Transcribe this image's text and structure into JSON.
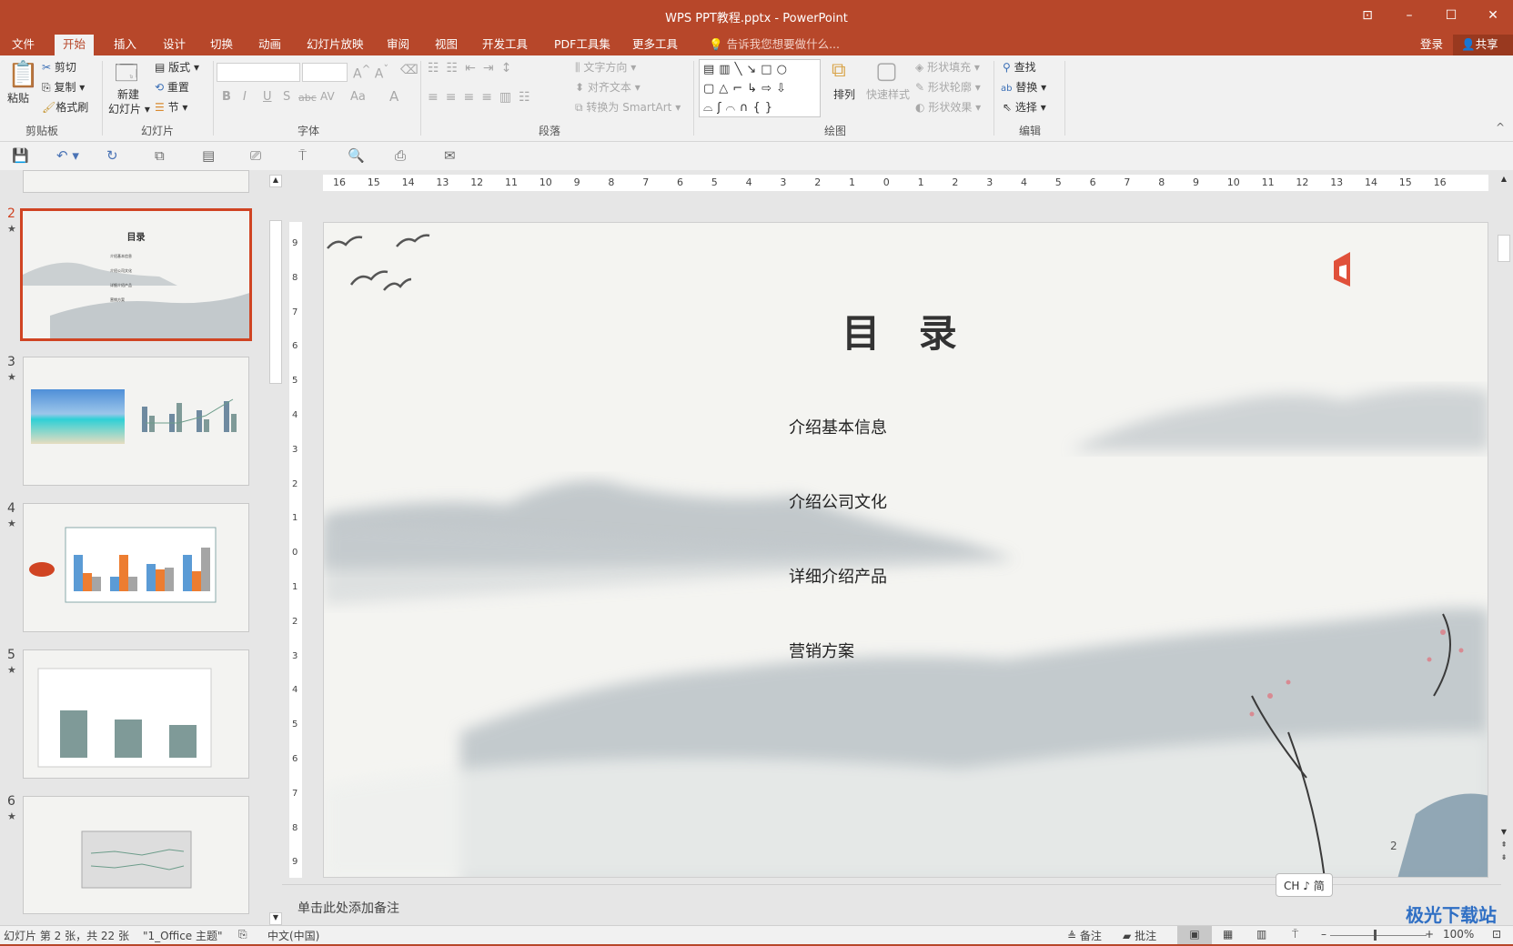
{
  "window": {
    "title": "WPS PPT教程.pptx - PowerPoint"
  },
  "tabs": [
    "文件",
    "开始",
    "插入",
    "设计",
    "切换",
    "动画",
    "幻灯片放映",
    "审阅",
    "视图",
    "开发工具",
    "PDF工具集",
    "更多工具"
  ],
  "tell_me": "告诉我您想要做什么...",
  "signin": "登录",
  "share": "共享",
  "ribbon": {
    "clipboard": {
      "paste": "粘贴",
      "cut": "剪切",
      "copy": "复制",
      "format_painter": "格式刷",
      "label": "剪贴板"
    },
    "slides": {
      "new_slide_1": "新建",
      "new_slide_2": "幻灯片",
      "layout": "版式",
      "reset": "重置",
      "section": "节",
      "label": "幻灯片"
    },
    "font": {
      "label": "字体",
      "bold": "B",
      "italic": "I",
      "underline": "U",
      "shadow": "S",
      "strike": "abc",
      "spacing": "AV",
      "case": "Aa",
      "color": "A"
    },
    "paragraph": {
      "text_direction": "文字方向",
      "align_text": "对齐文本",
      "smartart": "转换为 SmartArt",
      "label": "段落"
    },
    "drawing": {
      "arrange": "排列",
      "quick_styles": "快速样式",
      "shape_fill": "形状填充",
      "shape_outline": "形状轮廓",
      "shape_effects": "形状效果",
      "label": "绘图"
    },
    "editing": {
      "find": "查找",
      "replace": "替换",
      "select": "选择",
      "label": "编辑"
    }
  },
  "thumbnails": [
    {
      "num": "2",
      "star": "★",
      "title": "目录",
      "items": [
        "介绍基本信息",
        "介绍公司文化",
        "详细介绍产品",
        "营销方案"
      ]
    },
    {
      "num": "3",
      "star": "★"
    },
    {
      "num": "4",
      "star": "★"
    },
    {
      "num": "5",
      "star": "★"
    },
    {
      "num": "6",
      "star": "★"
    }
  ],
  "ruler_h": [
    "16",
    "15",
    "14",
    "13",
    "12",
    "11",
    "10",
    "9",
    "8",
    "7",
    "6",
    "5",
    "4",
    "3",
    "2",
    "1",
    "0",
    "1",
    "2",
    "3",
    "4",
    "5",
    "6",
    "7",
    "8",
    "9",
    "10",
    "11",
    "12",
    "13",
    "14",
    "15",
    "16"
  ],
  "ruler_v": [
    "9",
    "8",
    "7",
    "6",
    "5",
    "4",
    "3",
    "2",
    "1",
    "0",
    "1",
    "2",
    "3",
    "4",
    "5",
    "6",
    "7",
    "8",
    "9"
  ],
  "slide": {
    "title": "目 录",
    "items": [
      "介绍基本信息",
      "介绍公司文化",
      "详细介绍产品",
      "营销方案"
    ],
    "page_number": "2"
  },
  "notes_placeholder": "单击此处添加备注",
  "ime": "CH ♪ 简",
  "status": {
    "slide_info": "幻灯片 第 2 张，共 22 张",
    "theme": "\"1_Office 主题\"",
    "language": "中文(中国)",
    "notes": "备注",
    "comments": "批注",
    "zoom": "100%"
  },
  "watermark": "极光下载站",
  "colors": {
    "accent": "#b7472a",
    "selected_thumb": "#d04423"
  }
}
